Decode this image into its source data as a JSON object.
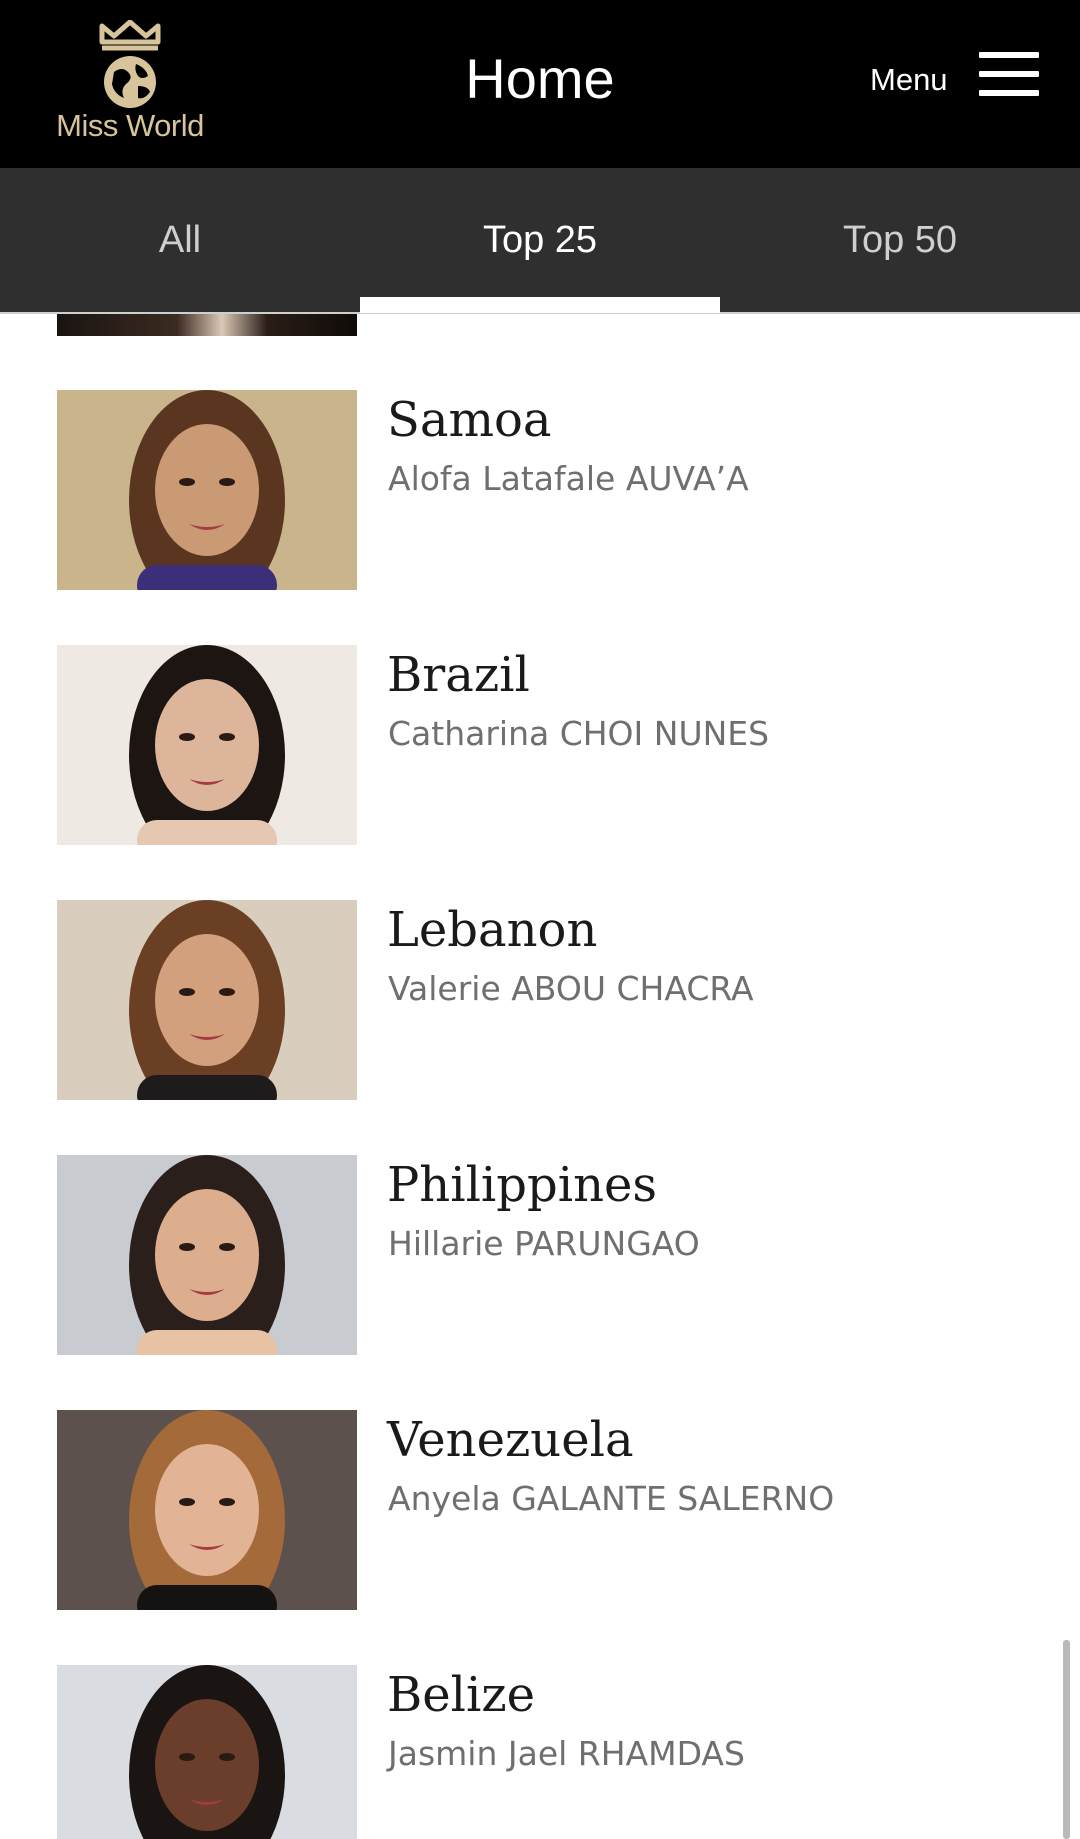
{
  "header": {
    "logo_text": "Miss World",
    "title": "Home",
    "menu_label": "Menu"
  },
  "tabs": [
    {
      "label": "All",
      "active": false
    },
    {
      "label": "Top 25",
      "active": true
    },
    {
      "label": "Top 50",
      "active": false
    }
  ],
  "contestants": [
    {
      "country": "Samoa",
      "name": "Alofa Latafale AUVA’A",
      "bg": "#c9b48c",
      "hair": "#5a3621",
      "skin": "#c99a73",
      "top": "#3a2f78"
    },
    {
      "country": "Brazil",
      "name": "Catharina CHOI NUNES",
      "bg": "#efe9e4",
      "hair": "#1c1512",
      "skin": "#dcb59a",
      "top": "#e6c7b1"
    },
    {
      "country": "Lebanon",
      "name": "Valerie ABOU CHACRA",
      "bg": "#d9cdbd",
      "hair": "#6a3f24",
      "skin": "#d3a07e",
      "top": "#1d1b1b"
    },
    {
      "country": "Philippines",
      "name": "Hillarie PARUNGAO",
      "bg": "#c8ccd1",
      "hair": "#2a1f1a",
      "skin": "#dcae8d",
      "top": "#e8c2a5"
    },
    {
      "country": "Venezuela",
      "name": "Anyela GALANTE SALERNO",
      "bg": "#5c514c",
      "hair": "#a56a3a",
      "skin": "#e2b394",
      "top": "#151212"
    },
    {
      "country": "Belize",
      "name": "Jasmin Jael RHAMDAS",
      "bg": "#d9dde1",
      "hair": "#1a1412",
      "skin": "#6a3e2a",
      "top": "#c98a7a"
    }
  ]
}
